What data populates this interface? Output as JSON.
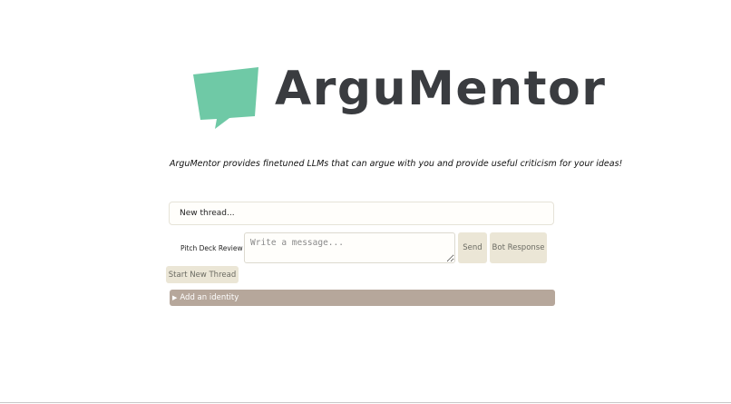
{
  "brand": {
    "name": "ArguMentor",
    "logo_color": "#6fc9a6",
    "text_color": "#3a3c40"
  },
  "tagline": "ArguMentor provides finetuned LLMs that can argue with you and provide useful criticism for your ideas!",
  "thread": {
    "current": "New thread..."
  },
  "composer": {
    "persona_selected": "Pitch Deck Review",
    "message_placeholder": "Write a message...",
    "message_value": "",
    "send_label": "Send",
    "bot_response_label": "Bot Response",
    "new_thread_label": "Start New Thread"
  },
  "identity": {
    "label": "Add an identity",
    "bar_color": "#b6a79b"
  },
  "icons": [
    "speech-bubble-logo-icon",
    "chevron-down-icon",
    "disclosure-triangle-icon"
  ]
}
